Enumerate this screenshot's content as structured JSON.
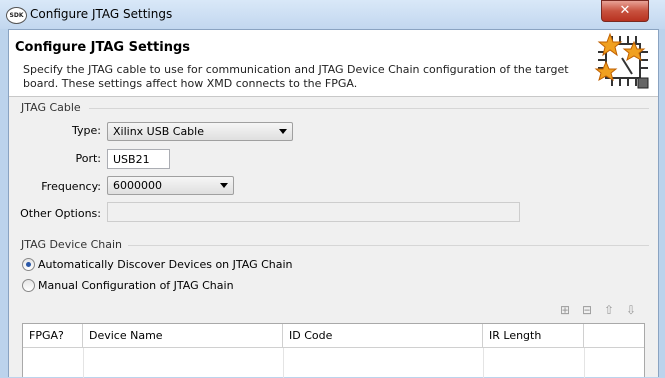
{
  "window": {
    "title": "Configure JTAG Settings",
    "app_badge": "SDK",
    "close_glyph": "✕"
  },
  "header": {
    "title": "Configure JTAG Settings",
    "description": "Specify the JTAG cable to use for communication and JTAG Device Chain configuration of the target board. These settings affect how XMD connects to the FPGA."
  },
  "jtag_cable": {
    "section_label": "JTAG Cable",
    "type_label": "Type:",
    "type_value": "Xilinx USB Cable",
    "port_label": "Port:",
    "port_value": "USB21",
    "frequency_label": "Frequency:",
    "frequency_value": "6000000",
    "other_options_label": "Other Options:",
    "other_options_value": ""
  },
  "device_chain": {
    "section_label": "JTAG Device Chain",
    "auto_label": "Automatically Discover Devices on JTAG Chain",
    "auto_selected": true,
    "manual_label": "Manual Configuration of JTAG Chain",
    "manual_selected": false,
    "toolbar_icons": [
      "add-device-icon",
      "remove-device-icon",
      "move-up-icon",
      "move-down-icon"
    ],
    "table": {
      "columns": [
        "FPGA?",
        "Device Name",
        "ID Code",
        "IR Length"
      ],
      "rows": []
    }
  }
}
